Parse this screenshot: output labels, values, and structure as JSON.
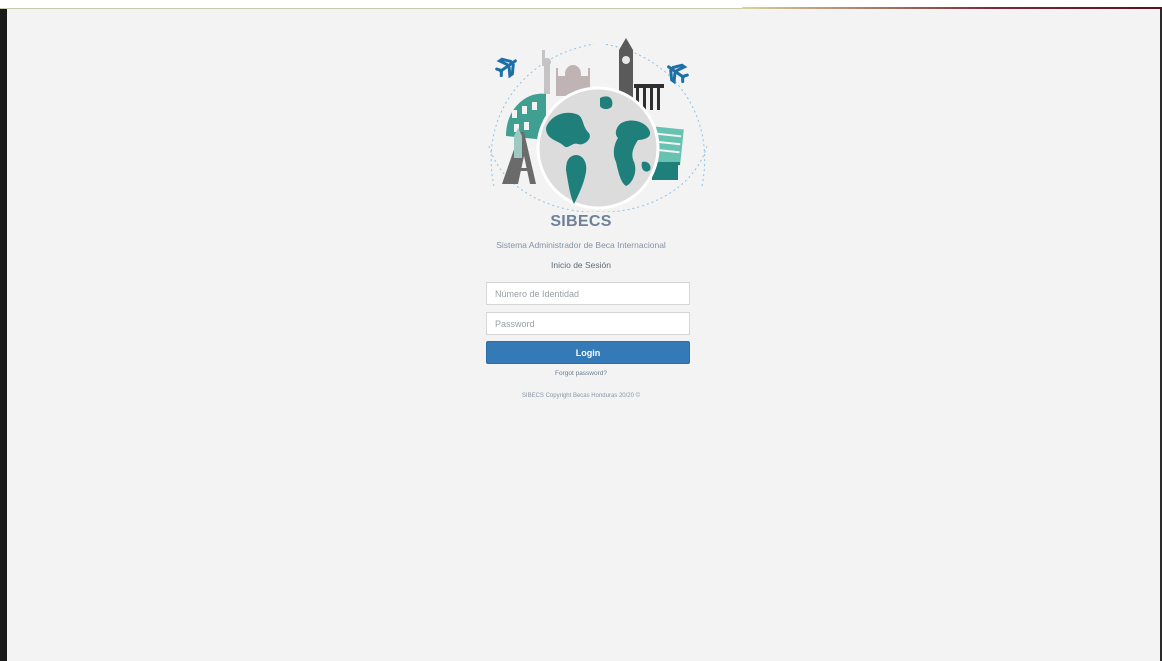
{
  "app": {
    "title": "SIBECS",
    "subtitle": "Sistema Administrador de Beca Internacional",
    "section_title": "Inicio de Sesión"
  },
  "form": {
    "id_field": {
      "placeholder": "Número de Identidad",
      "value": ""
    },
    "password_field": {
      "placeholder": "Password",
      "value": ""
    },
    "login_label": "Login",
    "forgot_label": "Forgot password?"
  },
  "footer": {
    "copyright": "SIBECS Copyright Becas Honduras 20/20 ©"
  },
  "logo": {
    "icon": "globe-landmarks-logo",
    "colors": {
      "teal": "#1f7f7a",
      "light_teal": "#5fb8a6",
      "gray": "#6b6b6b",
      "dashed": "#8fc3e0",
      "plane": "#1d6fa8"
    }
  },
  "colors": {
    "background": "#f3f3f3",
    "primary_button": "#337ab7",
    "title": "#6f8199"
  }
}
